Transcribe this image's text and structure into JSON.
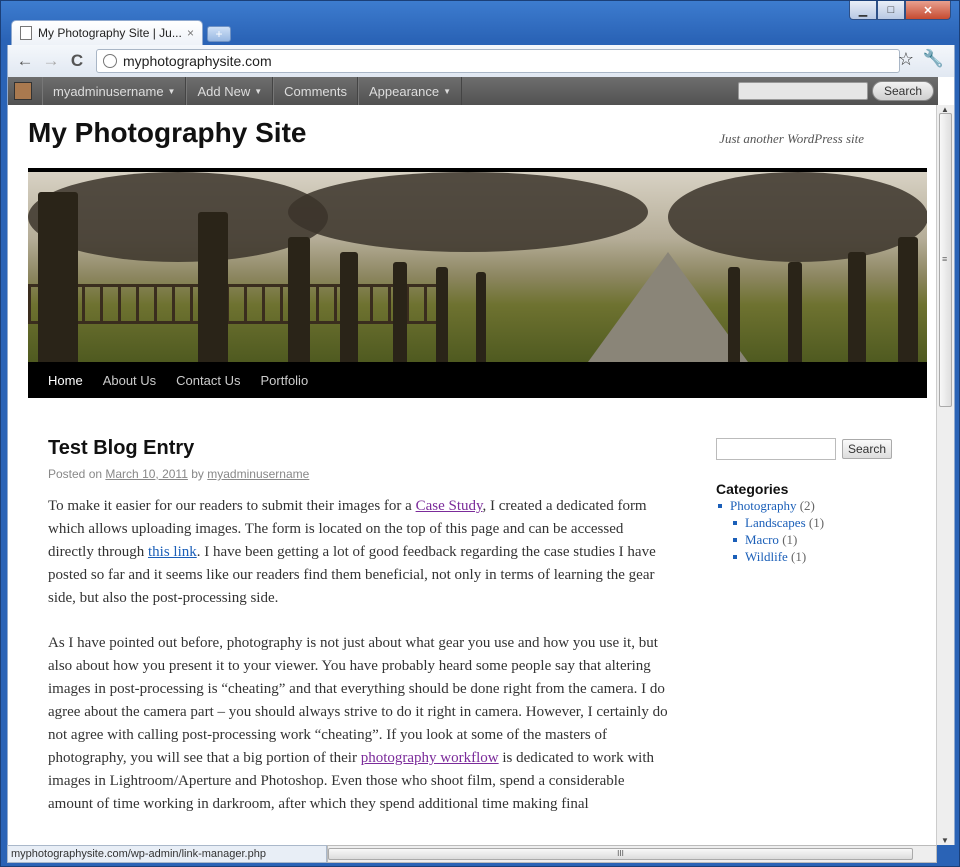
{
  "window": {
    "min_glyph": "▁",
    "max_glyph": "□",
    "close_glyph": "✕"
  },
  "browser": {
    "tab_title": "My Photography Site | Ju...",
    "tab_close": "×",
    "new_tab": "+",
    "back": "←",
    "forward": "→",
    "reload": "C",
    "url": "myphotographysite.com",
    "star": "☆",
    "wrench": "🔧",
    "status_url": "myphotographysite.com/wp-admin/link-manager.php"
  },
  "adminbar": {
    "items": [
      {
        "label": "myadminusername",
        "caret": "▼"
      },
      {
        "label": "Add New",
        "caret": "▼"
      },
      {
        "label": "Comments",
        "caret": ""
      },
      {
        "label": "Appearance",
        "caret": "▼"
      }
    ],
    "search_button": "Search"
  },
  "site": {
    "title": "My Photography Site",
    "tagline": "Just another WordPress site",
    "nav": [
      "Home",
      "About Us",
      "Contact Us",
      "Portfolio"
    ]
  },
  "post": {
    "title": "Test Blog Entry",
    "meta_posted": "Posted on",
    "meta_date": "March 10, 2011",
    "meta_by": "by",
    "meta_author": "myadminusername",
    "p1_a": "To make it easier for our readers to submit their images for a ",
    "p1_link1": "Case Study",
    "p1_b": ", I created a dedicated form which allows uploading images. The form is located on the top of this page and can be accessed directly through ",
    "p1_link2": "this link",
    "p1_c": ". I have been getting a lot of good feedback regarding the case studies I have posted so far and it seems like our readers find them beneficial, not only in terms of learning the gear side, but also the post-processing side.",
    "p2_a": "As I have pointed out before, photography is not just about what gear you use and how you use it, but also about how you present it to your viewer. You have probably heard some people say that altering images in post-processing is “cheating” and that everything should be done right from the camera. I do agree about the camera part – you should always strive to do it right in camera. However, I certainly do not agree with calling post-processing work “cheating”. If you look at some of the masters of photography, you will see that a big portion of their ",
    "p2_link": "photography workflow",
    "p2_b": " is dedicated to work with images in Lightroom/Aperture and Photoshop. Even those who shoot film, spend a considerable amount of time working in darkroom, after which they spend additional time making final"
  },
  "sidebar": {
    "search_button": "Search",
    "categories_title": "Categories",
    "categories": [
      {
        "name": "Photography",
        "count": "(2)"
      },
      {
        "name": "Landscapes",
        "count": "(1)"
      },
      {
        "name": "Macro",
        "count": "(1)"
      },
      {
        "name": "Wildlife",
        "count": "(1)"
      }
    ]
  },
  "scroll": {
    "grip": "≡",
    "hgrip": "III",
    "up": "▲",
    "down": "▼"
  }
}
